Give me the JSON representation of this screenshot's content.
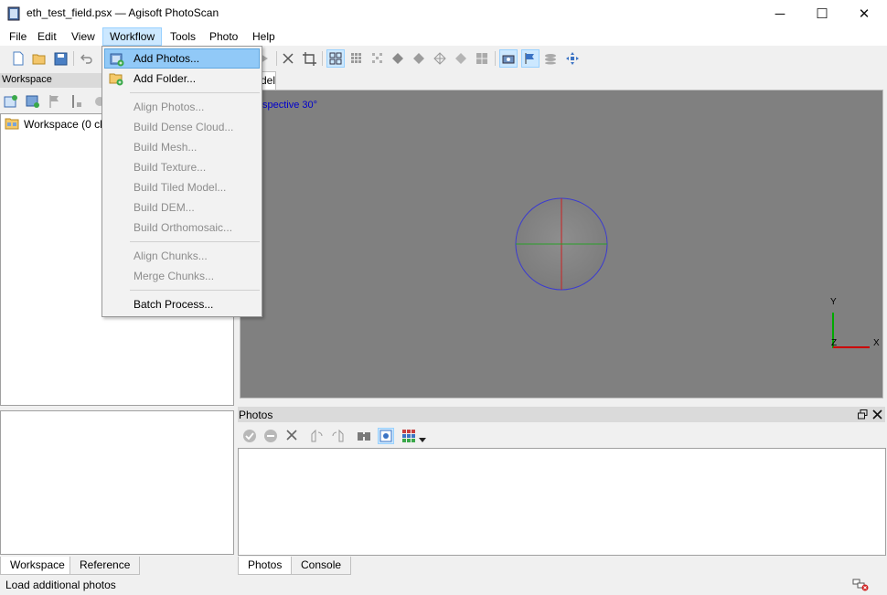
{
  "window": {
    "title": "eth_test_field.psx — Agisoft PhotoScan",
    "minimize": "─",
    "maximize": "☐",
    "close": "✕"
  },
  "menubar": {
    "items": [
      {
        "label": "File"
      },
      {
        "label": "Edit"
      },
      {
        "label": "View"
      },
      {
        "label": "Workflow"
      },
      {
        "label": "Tools"
      },
      {
        "label": "Photo"
      },
      {
        "label": "Help"
      }
    ]
  },
  "workflow_menu": {
    "items": [
      {
        "label": "Add Photos...",
        "state": "highlighted",
        "icon": "add-photos-icon"
      },
      {
        "label": "Add Folder...",
        "state": "enabled",
        "icon": "add-folder-icon"
      },
      {
        "label": "Align Photos...",
        "state": "disabled"
      },
      {
        "label": "Build Dense Cloud...",
        "state": "disabled"
      },
      {
        "label": "Build Mesh...",
        "state": "disabled"
      },
      {
        "label": "Build Texture...",
        "state": "disabled"
      },
      {
        "label": "Build Tiled Model...",
        "state": "disabled"
      },
      {
        "label": "Build DEM...",
        "state": "disabled"
      },
      {
        "label": "Build Orthomosaic...",
        "state": "disabled"
      },
      {
        "label": "Align Chunks...",
        "state": "disabled"
      },
      {
        "label": "Merge Chunks...",
        "state": "disabled"
      },
      {
        "label": "Batch Process...",
        "state": "enabled"
      }
    ]
  },
  "workspace": {
    "header": "Workspace",
    "tree_root": "Workspace (0 ch"
  },
  "model": {
    "tab_label": "del",
    "projection": "spective 30°",
    "axes": {
      "x": "X",
      "y": "Y",
      "z": "Z"
    }
  },
  "photos": {
    "header": "Photos"
  },
  "bottom_tabs_left": [
    "Workspace",
    "Reference"
  ],
  "bottom_tabs_right": [
    "Photos",
    "Console"
  ],
  "status": "Load additional photos",
  "colors": {
    "menu_highlight": "#91c9f7",
    "viewport_bg": "#808080",
    "axis_x": "#cc0000",
    "axis_y": "#00aa00",
    "projection_text": "#0000cc"
  }
}
